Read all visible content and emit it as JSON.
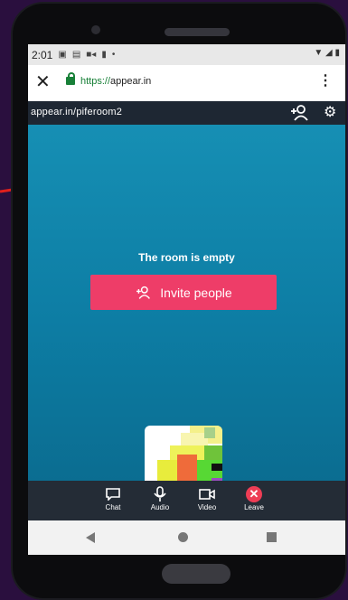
{
  "status_bar": {
    "time": "2:01",
    "icons": [
      "calendar-icon",
      "image-icon",
      "video-icon",
      "phone-icon",
      "dot-icon",
      "wifi-icon",
      "signal-icon",
      "battery-icon"
    ]
  },
  "browser": {
    "url_scheme": "https://",
    "url_host": "appear.in",
    "close_glyph": "✕",
    "menu_glyph": "⋮"
  },
  "room": {
    "url": "appear.in/piferoom2",
    "empty_text": "The room is empty",
    "invite_label": "Invite people"
  },
  "controls": [
    {
      "label": "Chat",
      "icon": "chat-icon"
    },
    {
      "label": "Audio",
      "icon": "microphone-icon"
    },
    {
      "label": "Video",
      "icon": "video-camera-icon"
    },
    {
      "label": "Leave",
      "icon": "leave-icon"
    }
  ],
  "colors": {
    "accent": "#ee3d68",
    "room_bg": "#168fb4",
    "bar_dark": "#242c36"
  }
}
